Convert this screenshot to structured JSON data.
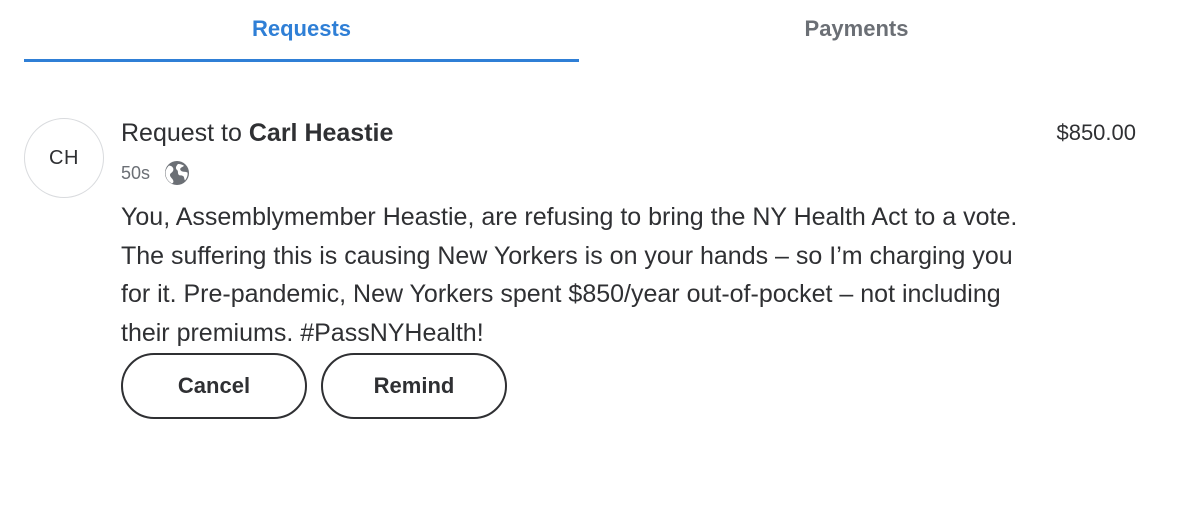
{
  "tabs": [
    {
      "label": "Requests",
      "active": true
    },
    {
      "label": "Payments",
      "active": false
    }
  ],
  "colors": {
    "accent": "#2f7fd6",
    "text": "#2f3033",
    "muted": "#6b6f75"
  },
  "request": {
    "avatar_initials": "CH",
    "title_prefix": "Request to ",
    "recipient": "Carl Heastie",
    "time": "50s",
    "privacy_icon": "globe-icon",
    "amount": "$850.00",
    "message": "You, Assemblymember Heastie, are refusing to bring the NY Health Act to a vote. The suffering this is causing New Yorkers is on your hands – so I’m charging you for it. Pre-pandemic, New Yorkers spent $850/year out-of-pocket – not including their premiums. #PassNYHealth!",
    "buttons": {
      "cancel": "Cancel",
      "remind": "Remind"
    }
  }
}
